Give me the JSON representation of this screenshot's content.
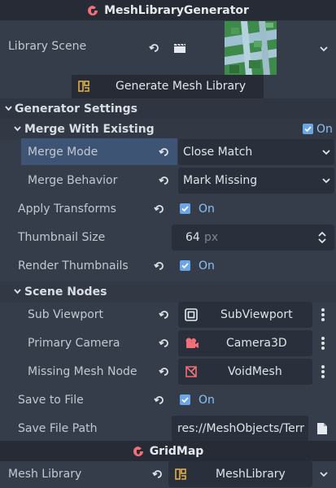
{
  "header1": {
    "title": "MeshLibraryGenerator",
    "icon": "godot-node-icon"
  },
  "library_scene": {
    "label": "Library Scene"
  },
  "generate_button": {
    "label": "Generate Mesh Library"
  },
  "generator_settings": {
    "title": "Generator Settings"
  },
  "merge_with_existing": {
    "title": "Merge With Existing",
    "on_label": "On",
    "checked": true
  },
  "merge_mode": {
    "label": "Merge Mode",
    "value": "Close Match"
  },
  "merge_behavior": {
    "label": "Merge Behavior",
    "value": "Mark Missing"
  },
  "apply_transforms": {
    "label": "Apply Transforms",
    "on_label": "On",
    "checked": true
  },
  "thumbnail_size": {
    "label": "Thumbnail Size",
    "value": "64",
    "unit": "px"
  },
  "render_thumbnails": {
    "label": "Render Thumbnails",
    "on_label": "On",
    "checked": true
  },
  "scene_nodes": {
    "title": "Scene Nodes"
  },
  "sub_viewport": {
    "label": "Sub Viewport",
    "value": "SubViewport"
  },
  "primary_camera": {
    "label": "Primary Camera",
    "value": "Camera3D"
  },
  "missing_mesh_node": {
    "label": "Missing Mesh Node",
    "value": "VoidMesh"
  },
  "save_to_file": {
    "label": "Save to File",
    "on_label": "On",
    "checked": true
  },
  "save_file_path": {
    "label": "Save File Path",
    "value": "res://MeshObjects/Terr"
  },
  "header2": {
    "title": "GridMap",
    "icon": "godot-node-icon"
  },
  "mesh_library": {
    "label": "Mesh Library",
    "value": "MeshLibrary"
  },
  "colors": {
    "accent": "#6aa6e8",
    "node_icon": "#f0707a",
    "resource_icon": "#e0b04a"
  }
}
